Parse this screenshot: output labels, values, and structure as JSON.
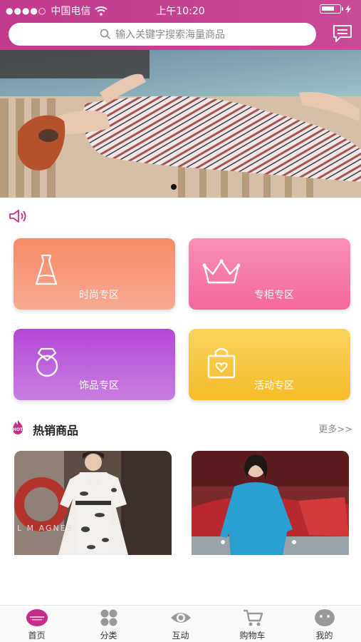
{
  "status_bar": {
    "carrier": "中国电信",
    "time": "上午10:20"
  },
  "search": {
    "placeholder": "输入关键字搜索海量商品"
  },
  "zones": [
    {
      "label": "时尚专区",
      "icon": "dress-icon",
      "color": "#f88a65"
    },
    {
      "label": "专柜专区",
      "icon": "crown-icon",
      "color": "#f3679d"
    },
    {
      "label": "饰品专区",
      "icon": "ring-icon",
      "color": "#b447d6"
    },
    {
      "label": "活动专区",
      "icon": "shopping-bag-icon",
      "color": "#f5bc28"
    }
  ],
  "hot": {
    "icon_text": "HOT",
    "title": "热销商品",
    "more": "更多>>"
  },
  "products": [
    {
      "image_text": "L M AGNES"
    },
    {
      "image_text": ""
    }
  ],
  "nav": [
    {
      "label": "首页",
      "icon": "home-avatar-icon"
    },
    {
      "label": "分类",
      "icon": "category-grid-icon"
    },
    {
      "label": "互动",
      "icon": "eye-icon"
    },
    {
      "label": "购物车",
      "icon": "cart-icon"
    },
    {
      "label": "我的",
      "icon": "profile-face-icon"
    }
  ],
  "colors": {
    "header": "#c03a8d",
    "accent": "#c62d8a"
  }
}
